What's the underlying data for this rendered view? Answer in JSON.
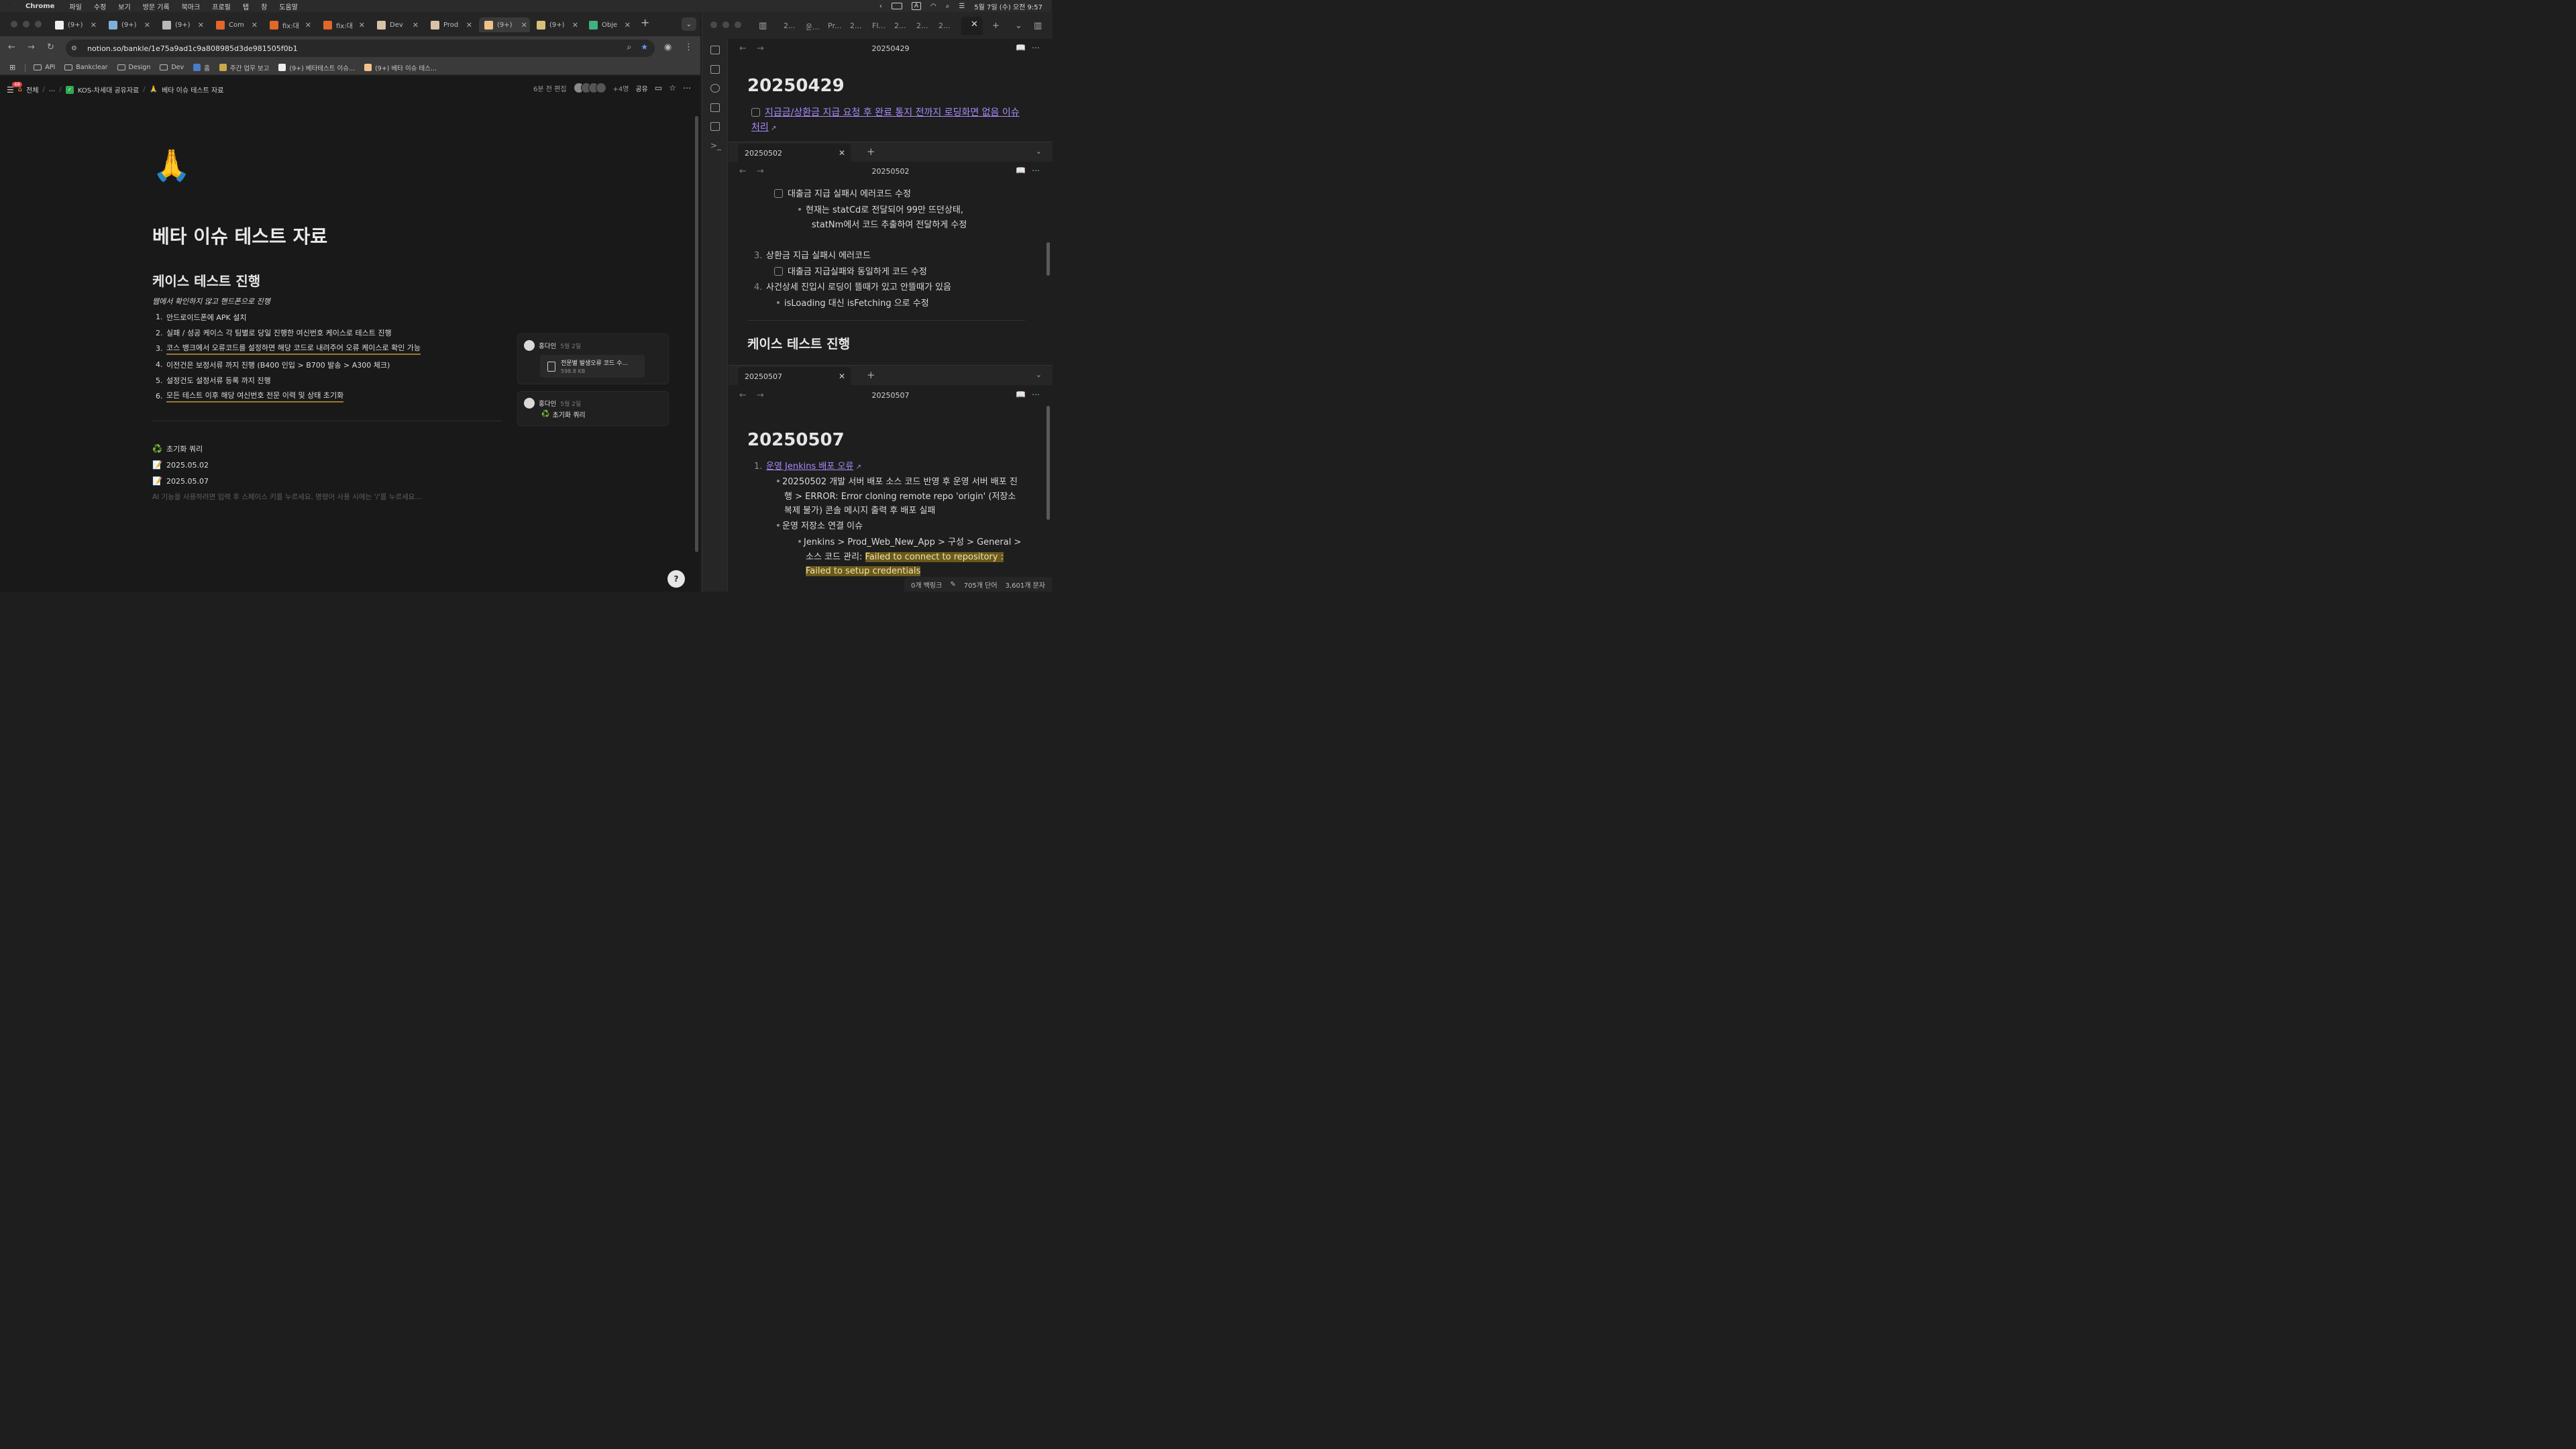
{
  "menubar": {
    "app": "Chrome",
    "items": [
      "파일",
      "수정",
      "보기",
      "방문 기록",
      "북마크",
      "프로필",
      "탭",
      "창",
      "도움말"
    ],
    "ime": "A",
    "clock": "5월 7일 (수) 오전 9:57"
  },
  "chrome": {
    "tabs": [
      {
        "label": "(9+)",
        "icon": "notion-icon"
      },
      {
        "label": "(9+)",
        "icon": "bird-icon"
      },
      {
        "label": "(9+)",
        "icon": "doc-icon"
      },
      {
        "label": "Com",
        "icon": "gitlab-icon"
      },
      {
        "label": "fix:대",
        "icon": "gitlab-icon"
      },
      {
        "label": "fix:대",
        "icon": "gitlab-icon"
      },
      {
        "label": "Dev",
        "icon": "avatar-icon"
      },
      {
        "label": "Prod",
        "icon": "avatar-icon"
      },
      {
        "label": "(9+)",
        "icon": "pray-icon"
      },
      {
        "label": "(9+)",
        "icon": "memo-icon"
      },
      {
        "label": "Obje",
        "icon": "vue-icon"
      }
    ],
    "url": "notion.so/bankle/1e75a9ad1c9a808985d3de981505f0b1",
    "bookmarks": [
      "API",
      "Bankclear",
      "Design",
      "Dev",
      "홈",
      "주간 업무 보고",
      "(9+) 베타테스트 이슈...",
      "(9+) 베타 이슈 테스..."
    ]
  },
  "notion": {
    "inbox_count": "48",
    "breadcrumb": [
      "전체",
      "...",
      "KOS-차세대 공유자료",
      "베타 이슈 테스트 자료"
    ],
    "edited": "6분 전 편집",
    "members": "+4명",
    "share": "공유",
    "page_icon": "🙏",
    "title": "베타 이슈 테스트 자료",
    "heading": "케이스 테스트 진행",
    "italic_note": "웹에서 확인하지 않고 핸드폰으로 진행",
    "steps": [
      {
        "n": "1.",
        "text": "안드로이드폰에 APK 설치"
      },
      {
        "n": "2.",
        "text": "실패 / 성공 케이스 각 팀별로 당일 진행한 여신번호 케이스로 테스트 진행"
      },
      {
        "n": "3.",
        "text": "코스 뱅크에서 오류코드를 설정하면 해당 코드로 내려주어 오류 케이스로 확인 가능"
      },
      {
        "n": "4.",
        "text": "이전건은 보정서류 까지 진행 (B400 인입 > B700 발송 > A300 체크)"
      },
      {
        "n": "5.",
        "text": "설정건도 설정서류 등록 까지 진행"
      },
      {
        "n": "6.",
        "text": "모든 테스트 이후 해당 여신번호 전문 이력 및 상태 초기화"
      }
    ],
    "subpages": [
      {
        "emoji": "♻️",
        "label": "초기화 쿼리"
      },
      {
        "emoji": "📝",
        "label": "2025.05.02"
      },
      {
        "emoji": "📝",
        "label": "2025.05.07"
      }
    ],
    "placeholder": "AI 기능을 사용하려면 입력 후 스페이스 키를 누르세요. 명령어 사용 시에는 '/'를 누르세요...",
    "comments": [
      {
        "author": "홍다인",
        "date": "5월 2일",
        "file_name": "전문별 발생오류 코드 수...",
        "file_size": "598.8 KB"
      },
      {
        "author": "홍다인",
        "date": "5월 2일",
        "link": "초기화 쿼리"
      }
    ]
  },
  "obsidian": {
    "tabs": [
      "2...",
      "운...",
      "Pr...",
      "2...",
      "Fl...",
      "2...",
      "2...",
      "2..."
    ],
    "pane1": {
      "title": "20250429",
      "h1": "20250429",
      "todo_link": "지급금/상환금 지급 요청 후 완료 통지 전까지 로딩화면 없음 이슈 처리"
    },
    "pane2": {
      "tab": "20250502",
      "title": "20250502",
      "task1": "대출금 지급 실패시 에러코드 수정",
      "note1": "현재는 statCd로 전달되어 99만 뜨던상태,",
      "note1b": "statNm에서 코드 추출하여 전달하게 수정",
      "item3": "상환금 지급 실패시 에러코드",
      "task3": "대출금 지급실패와 동일하게 코드 수정",
      "item4": "사건상세 진입시 로딩이 뜰때가 있고 안뜰때가 있음",
      "note4": "isLoading 대신 isFetching 으로 수정",
      "next_heading": "케이스 테스트 진행"
    },
    "pane3": {
      "tab": "20250507",
      "title": "20250507",
      "h1": "20250507",
      "item1": "운영 Jenkins 배포 오류",
      "b1": "20250502 개발 서버 배포 소스 코드 반영 후 운영 서버 배포 진행 > ERROR: Error cloning remote repo 'origin' (저장소 복제 불가) 콘솔 메시지 출력 후 배포 실패",
      "b2": "운영 저장소 연결 이슈",
      "b3": "Jenkins > Prod_Web_New_App > 구성 > General > 소스 코드 관리:",
      "b3_highlight": "Failed to connect to repository : Failed to setup credentials"
    },
    "status": {
      "backlinks": "0개 백링크",
      "words": "705개 단어",
      "chars": "3,601개 문자"
    }
  },
  "colors": {
    "accent_link": "#a68af9",
    "highlight": "#6b5a1c",
    "notion_bg": "#191919"
  }
}
